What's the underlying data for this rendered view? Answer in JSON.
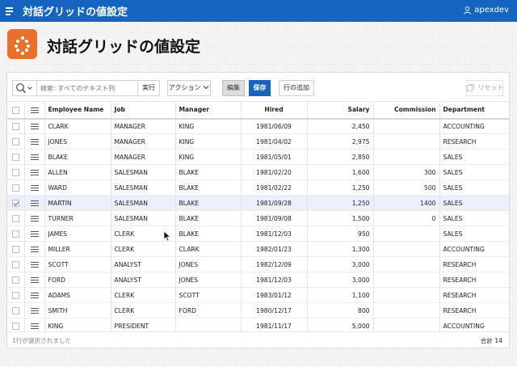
{
  "app": {
    "title": "対話グリッドの値設定",
    "user": "apexdev"
  },
  "page": {
    "title": "対話グリッドの値設定"
  },
  "toolbar": {
    "search_placeholder": "検索: すべてのテキスト列",
    "go_label": "実行",
    "actions_label": "アクション",
    "edit_label": "編集",
    "save_label": "保存",
    "add_row_label": "行の追加",
    "reset_label": "リセット"
  },
  "grid": {
    "columns": [
      "Employee Name",
      "Job",
      "Manager",
      "Hired",
      "Salary",
      "Commission",
      "Department"
    ],
    "rows": [
      {
        "name": "CLARK",
        "job": "MANAGER",
        "manager": "KING",
        "hired": "1981/06/09",
        "salary": "2,450",
        "commission": "",
        "department": "ACCOUNTING",
        "selected": false
      },
      {
        "name": "JONES",
        "job": "MANAGER",
        "manager": "KING",
        "hired": "1981/04/02",
        "salary": "2,975",
        "commission": "",
        "department": "RESEARCH",
        "selected": false
      },
      {
        "name": "BLAKE",
        "job": "MANAGER",
        "manager": "KING",
        "hired": "1981/05/01",
        "salary": "2,850",
        "commission": "",
        "department": "SALES",
        "selected": false
      },
      {
        "name": "ALLEN",
        "job": "SALESMAN",
        "manager": "BLAKE",
        "hired": "1981/02/20",
        "salary": "1,600",
        "commission": "300",
        "department": "SALES",
        "selected": false
      },
      {
        "name": "WARD",
        "job": "SALESMAN",
        "manager": "BLAKE",
        "hired": "1981/02/22",
        "salary": "1,250",
        "commission": "500",
        "department": "SALES",
        "selected": false
      },
      {
        "name": "MARTIN",
        "job": "SALESMAN",
        "manager": "BLAKE",
        "hired": "1981/09/28",
        "salary": "1,250",
        "commission": "1400",
        "department": "SALES",
        "selected": true
      },
      {
        "name": "TURNER",
        "job": "SALESMAN",
        "manager": "BLAKE",
        "hired": "1981/09/08",
        "salary": "1,500",
        "commission": "0",
        "department": "SALES",
        "selected": false
      },
      {
        "name": "JAMES",
        "job": "CLERK",
        "manager": "BLAKE",
        "hired": "1981/12/03",
        "salary": "950",
        "commission": "",
        "department": "SALES",
        "selected": false
      },
      {
        "name": "MILLER",
        "job": "CLERK",
        "manager": "CLARK",
        "hired": "1982/01/23",
        "salary": "1,300",
        "commission": "",
        "department": "ACCOUNTING",
        "selected": false
      },
      {
        "name": "SCOTT",
        "job": "ANALYST",
        "manager": "JONES",
        "hired": "1982/12/09",
        "salary": "3,000",
        "commission": "",
        "department": "RESEARCH",
        "selected": false
      },
      {
        "name": "FORD",
        "job": "ANALYST",
        "manager": "JONES",
        "hired": "1981/12/03",
        "salary": "3,000",
        "commission": "",
        "department": "RESEARCH",
        "selected": false
      },
      {
        "name": "ADAMS",
        "job": "CLERK",
        "manager": "SCOTT",
        "hired": "1983/01/12",
        "salary": "1,100",
        "commission": "",
        "department": "RESEARCH",
        "selected": false
      },
      {
        "name": "SMITH",
        "job": "CLERK",
        "manager": "FORD",
        "hired": "1980/12/17",
        "salary": "800",
        "commission": "",
        "department": "RESEARCH",
        "selected": false
      },
      {
        "name": "KING",
        "job": "PRESIDENT",
        "manager": "",
        "hired": "1981/11/17",
        "salary": "5,000",
        "commission": "",
        "department": "ACCOUNTING",
        "selected": false
      }
    ]
  },
  "footer": {
    "selection_status": "1行が選択されました",
    "total": "合計 14"
  },
  "colors": {
    "header_blue": "#1565c0",
    "page_icon": "#e8702a",
    "selected_row": "#e8f0fa"
  }
}
